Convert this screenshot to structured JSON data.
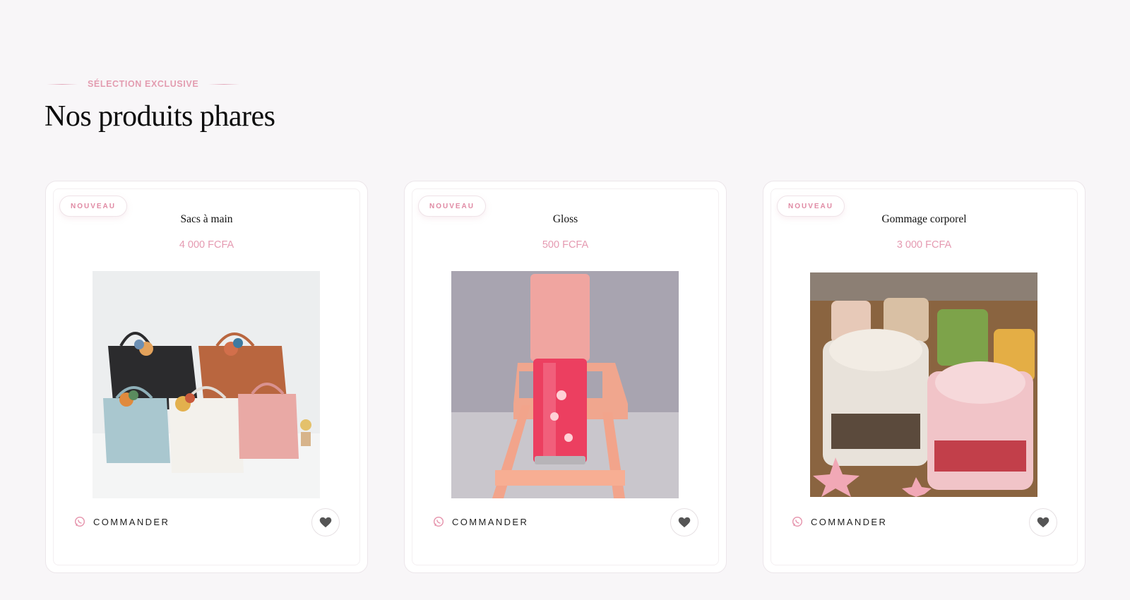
{
  "section": {
    "eyebrow": "SÉLECTION EXCLUSIVE",
    "title": "Nos produits phares"
  },
  "products": [
    {
      "badge": "NOUVEAU",
      "name": "Sacs à main",
      "price": "4 000 FCFA",
      "order_label": "COMMANDER",
      "image": "handbags-photo"
    },
    {
      "badge": "NOUVEAU",
      "name": "Gloss",
      "price": "500 FCFA",
      "order_label": "COMMANDER",
      "image": "lip-gloss-photo"
    },
    {
      "badge": "NOUVEAU",
      "name": "Gommage corporel",
      "price": "3 000 FCFA",
      "order_label": "COMMANDER",
      "image": "body-scrub-jars-photo"
    }
  ],
  "icons": {
    "order": "whatsapp-icon",
    "favorite": "heart-icon"
  },
  "colors": {
    "accent": "#e59ab1",
    "background": "#f8f6f8",
    "card": "#ffffff"
  }
}
